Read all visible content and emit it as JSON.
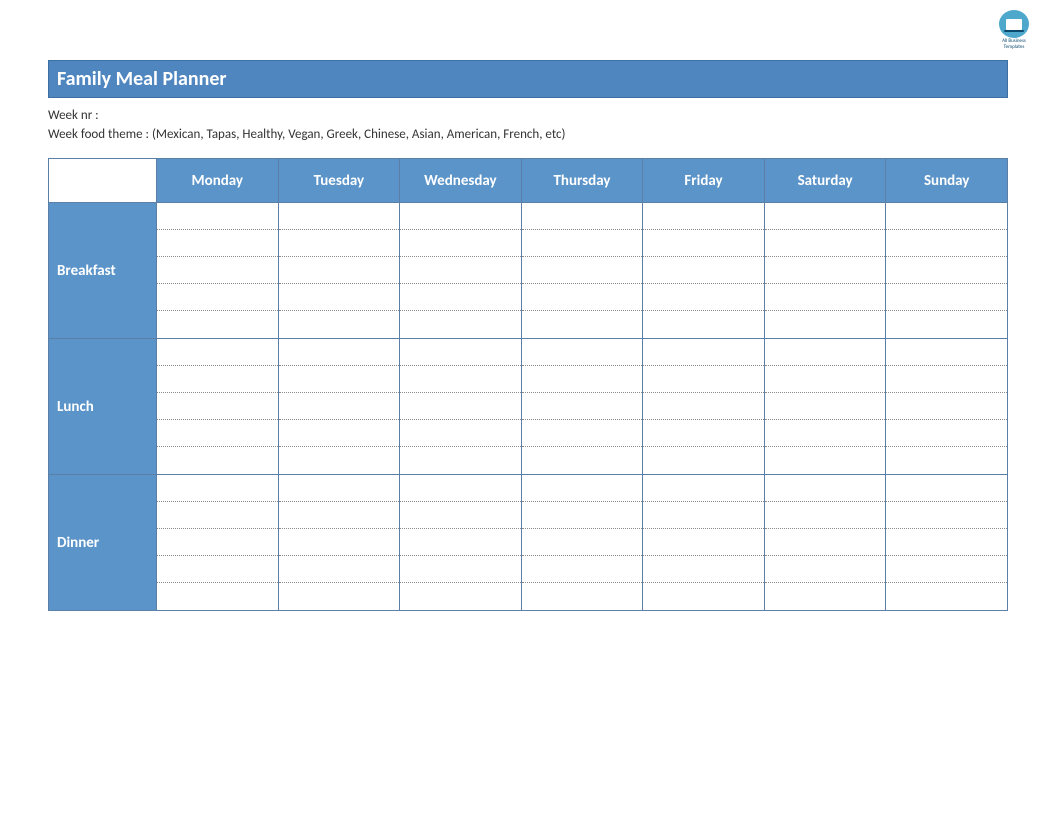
{
  "logo": {
    "line1": "All Business",
    "line2": "Templates"
  },
  "title": "Family Meal Planner",
  "meta": {
    "week_nr_label": "Week nr :",
    "week_nr_value": "",
    "theme_label": "Week food theme :",
    "theme_value": "(Mexican, Tapas, Healthy, Vegan, Greek, Chinese, Asian, American, French, etc)"
  },
  "days": [
    "Monday",
    "Tuesday",
    "Wednesday",
    "Thursday",
    "Friday",
    "Saturday",
    "Sunday"
  ],
  "meals": [
    "Breakfast",
    "Lunch",
    "Dinner"
  ],
  "slots_per_meal": 5,
  "colors": {
    "accent": "#5b94c9",
    "title_bar": "#4f86c0",
    "border": "#5b7fa6"
  }
}
